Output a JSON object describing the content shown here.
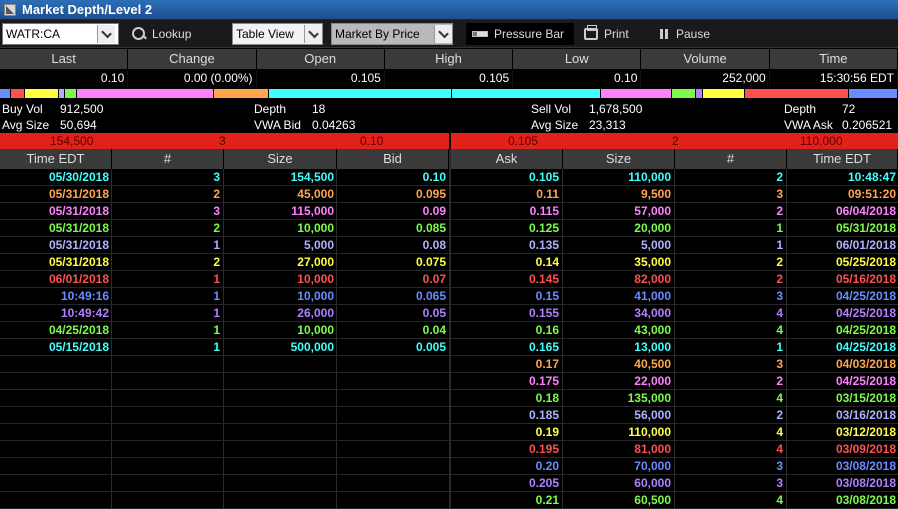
{
  "window": {
    "title": "Market Depth/Level 2"
  },
  "toolbar": {
    "symbol": "WATR:CA",
    "lookup_label": "Lookup",
    "view_select": "Table View",
    "mode_select": "Market By Price",
    "pressure_bar_label": "Pressure Bar",
    "print_label": "Print",
    "pause_label": "Pause"
  },
  "quote": {
    "headers": [
      "Last",
      "Change",
      "Open",
      "High",
      "Low",
      "Volume",
      "Time"
    ],
    "values": [
      "0.10",
      "0.00 (0.00%)",
      "0.105",
      "0.105",
      "0.10",
      "252,000",
      "15:30:56 EDT"
    ]
  },
  "pressure_bar": {
    "segments": [
      {
        "color": "#6a8cff",
        "weight": 11
      },
      {
        "color": "#ff5050",
        "weight": 14
      },
      {
        "color": "#ffff40",
        "weight": 33
      },
      {
        "color": "#b0b0ff",
        "weight": 6
      },
      {
        "color": "#7cfc4a",
        "weight": 12
      },
      {
        "color": "#ff80ff",
        "weight": 136
      },
      {
        "color": "#ffa64d",
        "weight": 54
      },
      {
        "color": "#40ffff",
        "weight": 182
      },
      {
        "color": "#40ffff",
        "weight": 147
      },
      {
        "color": "#ff80ff",
        "weight": 70
      },
      {
        "color": "#7cfc4a",
        "weight": 24
      },
      {
        "color": "#b080ff",
        "weight": 7
      },
      {
        "color": "#ffff40",
        "weight": 42
      },
      {
        "color": "#ff5050",
        "weight": 103
      },
      {
        "color": "#6a8cff",
        "weight": 48
      }
    ]
  },
  "stats": {
    "buy_vol_label": "Buy Vol",
    "buy_vol": "912,500",
    "avg_size_label": "Avg Size",
    "buy_avg_size": "50,694",
    "bid_depth_label": "Depth",
    "bid_depth": "18",
    "vwa_bid_label": "VWA Bid",
    "vwa_bid": "0.04263",
    "sell_vol_label": "Sell Vol",
    "sell_vol": "1,678,500",
    "sell_avg_size_label": "Avg Size",
    "sell_avg_size": "23,313",
    "ask_depth_label": "Depth",
    "ask_depth": "72",
    "vwa_ask_label": "VWA Ask",
    "vwa_ask": "0.206521"
  },
  "best": {
    "bid_size": "154,500",
    "bid_count": "3",
    "bid_price": "0.10",
    "ask_price": "0.105",
    "ask_count": "2",
    "ask_size": "110,000"
  },
  "columns": {
    "bid": [
      "Time EDT",
      "#",
      "Size",
      "Bid"
    ],
    "ask": [
      "Ask",
      "Size",
      "#",
      "Time EDT"
    ]
  },
  "bids": [
    {
      "time": "05/30/2018",
      "count": "3",
      "size": "154,500",
      "price": "0.10",
      "color": "#40ffff"
    },
    {
      "time": "05/31/2018",
      "count": "2",
      "size": "45,000",
      "price": "0.095",
      "color": "#ffa64d"
    },
    {
      "time": "05/31/2018",
      "count": "3",
      "size": "115,000",
      "price": "0.09",
      "color": "#ff80ff"
    },
    {
      "time": "05/31/2018",
      "count": "2",
      "size": "10,000",
      "price": "0.085",
      "color": "#7cfc4a"
    },
    {
      "time": "05/31/2018",
      "count": "1",
      "size": "5,000",
      "price": "0.08",
      "color": "#b0b0ff"
    },
    {
      "time": "05/31/2018",
      "count": "2",
      "size": "27,000",
      "price": "0.075",
      "color": "#ffff40"
    },
    {
      "time": "06/01/2018",
      "count": "1",
      "size": "10,000",
      "price": "0.07",
      "color": "#ff5050"
    },
    {
      "time": "10:49:16",
      "count": "1",
      "size": "10,000",
      "price": "0.065",
      "color": "#6a8cff"
    },
    {
      "time": "10:49:42",
      "count": "1",
      "size": "26,000",
      "price": "0.05",
      "color": "#b080ff"
    },
    {
      "time": "04/25/2018",
      "count": "1",
      "size": "10,000",
      "price": "0.04",
      "color": "#7cfc4a"
    },
    {
      "time": "05/15/2018",
      "count": "1",
      "size": "500,000",
      "price": "0.005",
      "color": "#40ffff"
    }
  ],
  "asks": [
    {
      "price": "0.105",
      "size": "110,000",
      "count": "2",
      "time": "10:48:47",
      "color": "#40ffff"
    },
    {
      "price": "0.11",
      "size": "9,500",
      "count": "3",
      "time": "09:51:20",
      "color": "#ffa64d"
    },
    {
      "price": "0.115",
      "size": "57,000",
      "count": "2",
      "time": "06/04/2018",
      "color": "#ff80ff"
    },
    {
      "price": "0.125",
      "size": "20,000",
      "count": "1",
      "time": "05/31/2018",
      "color": "#7cfc4a"
    },
    {
      "price": "0.135",
      "size": "5,000",
      "count": "1",
      "time": "06/01/2018",
      "color": "#b0b0ff"
    },
    {
      "price": "0.14",
      "size": "35,000",
      "count": "2",
      "time": "05/25/2018",
      "color": "#ffff40"
    },
    {
      "price": "0.145",
      "size": "82,000",
      "count": "2",
      "time": "05/16/2018",
      "color": "#ff5050"
    },
    {
      "price": "0.15",
      "size": "41,000",
      "count": "3",
      "time": "04/25/2018",
      "color": "#6a8cff"
    },
    {
      "price": "0.155",
      "size": "34,000",
      "count": "4",
      "time": "04/25/2018",
      "color": "#b080ff"
    },
    {
      "price": "0.16",
      "size": "43,000",
      "count": "4",
      "time": "04/25/2018",
      "color": "#7cfc4a"
    },
    {
      "price": "0.165",
      "size": "13,000",
      "count": "1",
      "time": "04/25/2018",
      "color": "#40ffff"
    },
    {
      "price": "0.17",
      "size": "40,500",
      "count": "3",
      "time": "04/03/2018",
      "color": "#ffa64d"
    },
    {
      "price": "0.175",
      "size": "22,000",
      "count": "2",
      "time": "04/25/2018",
      "color": "#ff80ff"
    },
    {
      "price": "0.18",
      "size": "135,000",
      "count": "4",
      "time": "03/15/2018",
      "color": "#7cfc4a"
    },
    {
      "price": "0.185",
      "size": "56,000",
      "count": "2",
      "time": "03/16/2018",
      "color": "#b0b0ff"
    },
    {
      "price": "0.19",
      "size": "110,000",
      "count": "4",
      "time": "03/12/2018",
      "color": "#ffff40"
    },
    {
      "price": "0.195",
      "size": "81,000",
      "count": "4",
      "time": "03/09/2018",
      "color": "#ff5050"
    },
    {
      "price": "0.20",
      "size": "70,000",
      "count": "3",
      "time": "03/08/2018",
      "color": "#6a8cff"
    },
    {
      "price": "0.205",
      "size": "60,000",
      "count": "3",
      "time": "03/08/2018",
      "color": "#b080ff"
    },
    {
      "price": "0.21",
      "size": "60,500",
      "count": "4",
      "time": "03/08/2018",
      "color": "#7cfc4a"
    }
  ]
}
